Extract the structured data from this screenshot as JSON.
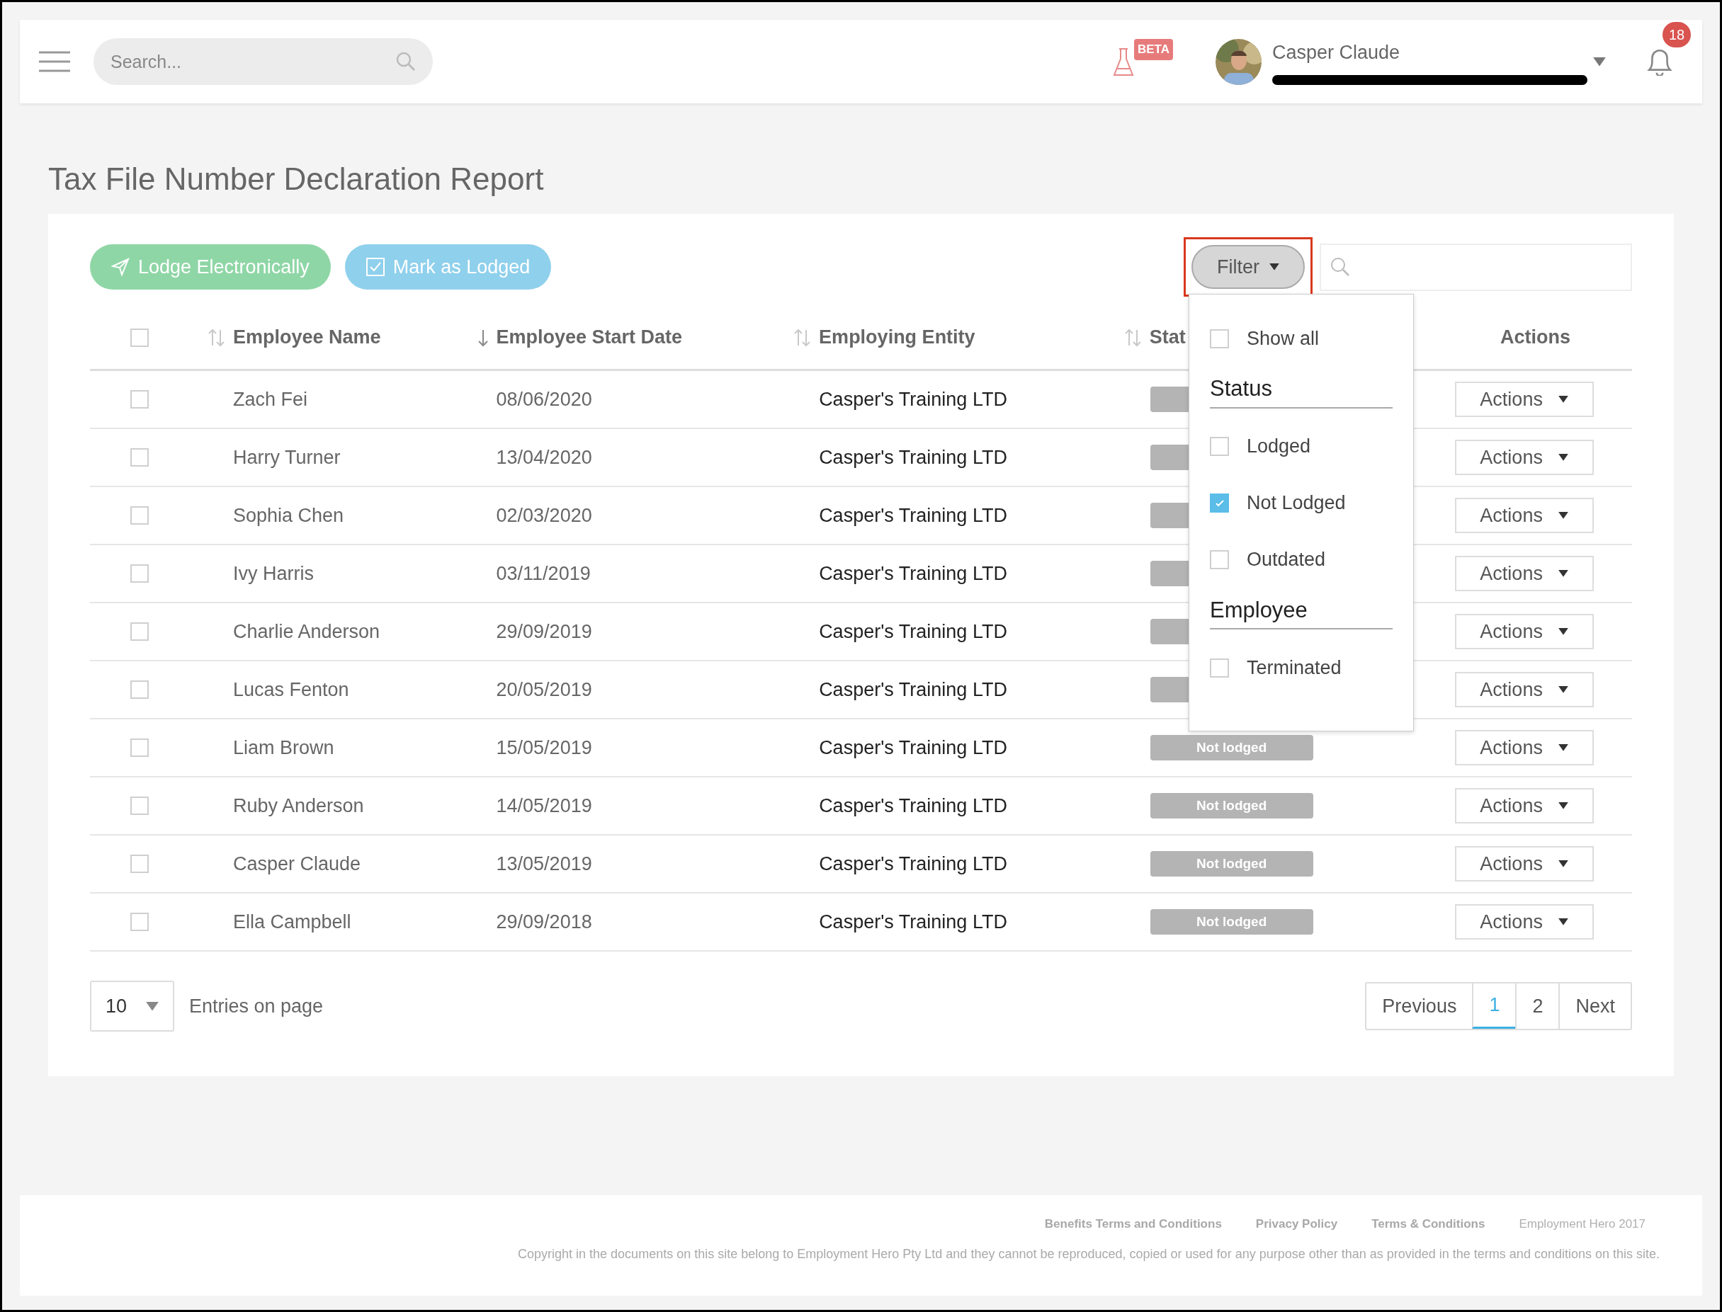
{
  "header": {
    "search": {
      "placeholder": "Search..."
    },
    "beta_badge": "BETA",
    "user": {
      "name": "Casper Claude"
    },
    "notifications": "18"
  },
  "page_title": "Tax File Number Declaration Report",
  "toolbar": {
    "buttons": [
      {
        "label": "Lodge Electronically",
        "kind": "lodge"
      },
      {
        "label": "Mark as Lodged",
        "kind": "mark"
      }
    ],
    "filter": {
      "label": "Filter",
      "highlighted": true
    }
  },
  "filter_menu": [
    {
      "kind": "checkbox",
      "label": "Show all",
      "checked": false
    },
    {
      "kind": "heading",
      "label": "Status"
    },
    {
      "kind": "checkbox",
      "label": "Lodged",
      "checked": false
    },
    {
      "kind": "checkbox",
      "label": "Not Lodged",
      "checked": true
    },
    {
      "kind": "checkbox",
      "label": "Outdated",
      "checked": false
    },
    {
      "kind": "heading",
      "label": "Employee"
    },
    {
      "kind": "checkbox",
      "label": "Terminated",
      "checked": false
    }
  ],
  "table": {
    "select_all": {
      "checked": false
    },
    "columns": [
      {
        "label": "Employee Name",
        "kind": "sortable"
      },
      {
        "label": "Employee Start Date",
        "kind": "sorted"
      },
      {
        "label": "Employing Entity",
        "kind": "sortable"
      },
      {
        "label": "Stat",
        "kind": "sortable"
      },
      {
        "label": "Actions",
        "kind": "plain"
      }
    ],
    "rows": [
      {
        "checked": false,
        "name": "Zach Fei",
        "start": "08/06/2020",
        "entity": "Casper's Training LTD",
        "action": "Actions"
      },
      {
        "checked": false,
        "name": "Harry Turner",
        "start": "13/04/2020",
        "entity": "Casper's Training LTD",
        "action": "Actions"
      },
      {
        "checked": false,
        "name": "Sophia Chen",
        "start": "02/03/2020",
        "entity": "Casper's Training LTD",
        "action": "Actions"
      },
      {
        "checked": false,
        "name": "Ivy Harris",
        "start": "03/11/2019",
        "entity": "Casper's Training LTD",
        "action": "Actions"
      },
      {
        "checked": false,
        "name": "Charlie Anderson",
        "start": "29/09/2019",
        "entity": "Casper's Training LTD",
        "action": "Actions"
      },
      {
        "checked": false,
        "name": "Lucas Fenton",
        "start": "20/05/2019",
        "entity": "Casper's Training LTD",
        "action": "Actions"
      },
      {
        "checked": false,
        "name": "Liam Brown",
        "start": "15/05/2019",
        "entity": "Casper's Training LTD",
        "status": "Not lodged",
        "action": "Actions"
      },
      {
        "checked": false,
        "name": "Ruby Anderson",
        "start": "14/05/2019",
        "entity": "Casper's Training LTD",
        "status": "Not lodged",
        "action": "Actions"
      },
      {
        "checked": false,
        "name": "Casper Claude",
        "start": "13/05/2019",
        "entity": "Casper's Training LTD",
        "status": "Not lodged",
        "action": "Actions"
      },
      {
        "checked": false,
        "name": "Ella Campbell",
        "start": "29/09/2018",
        "entity": "Casper's Training LTD",
        "status": "Not lodged",
        "action": "Actions"
      }
    ]
  },
  "page_size": "10",
  "page_size_label": "Entries on page",
  "pagination": [
    {
      "label": "Previous",
      "selected": false
    },
    {
      "label": "1",
      "selected": true
    },
    {
      "label": "2",
      "selected": false
    },
    {
      "label": "Next",
      "selected": false
    }
  ],
  "footer": {
    "links": [
      "Benefits Terms and Conditions",
      "Privacy Policy",
      "Terms & Conditions"
    ],
    "brand": "Employment Hero 2017",
    "copyright": "Copyright in the documents on this site belong to Employment Hero Pty Ltd and they cannot be reproduced, copied or used for any purpose other than as provided in the terms and conditions on this site."
  }
}
